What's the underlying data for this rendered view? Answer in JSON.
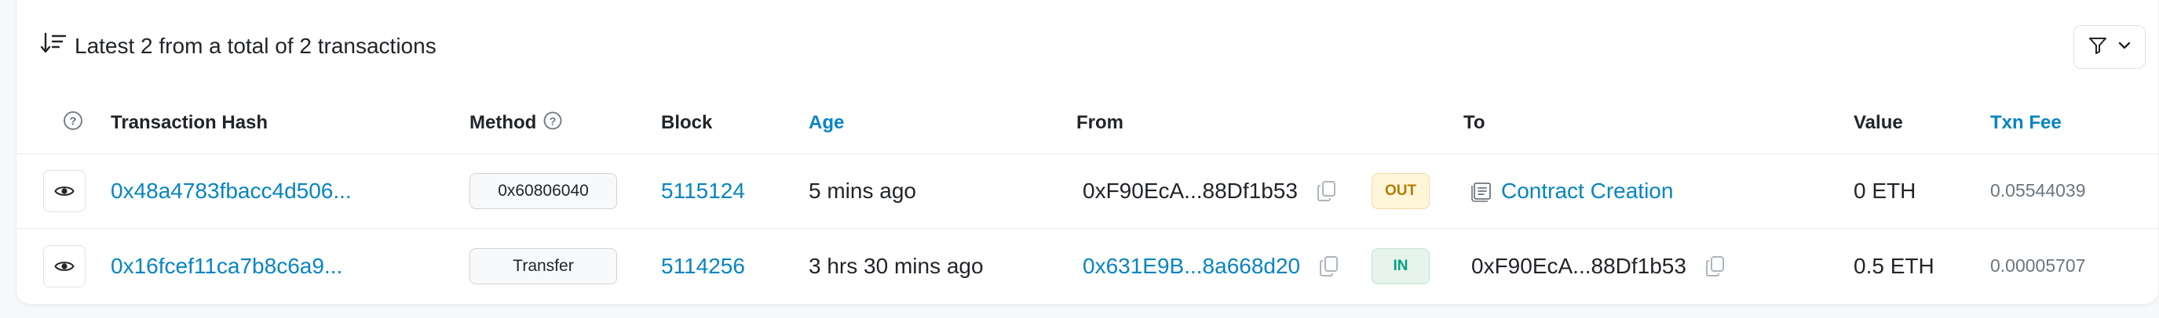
{
  "header": {
    "summary": "Latest 2 from a total of 2 transactions"
  },
  "columns": {
    "help": "?",
    "tx_hash": "Transaction Hash",
    "method": "Method",
    "block": "Block",
    "age": "Age",
    "from": "From",
    "to": "To",
    "value": "Value",
    "fee": "Txn Fee"
  },
  "rows": [
    {
      "hash": "0x48a4783fbacc4d506...",
      "method": "0x60806040",
      "block": "5115124",
      "age": "5 mins ago",
      "from": "0xF90EcA...88Df1b53",
      "direction": "OUT",
      "to": "Contract Creation",
      "value": "0 ETH",
      "fee": "0.05544039"
    },
    {
      "hash": "0x16fcef11ca7b8c6a9...",
      "method": "Transfer",
      "block": "5114256",
      "age": "3 hrs 30 mins ago",
      "from": "0x631E9B...8a668d20",
      "direction": "IN",
      "to": "0xF90EcA...88Df1b53",
      "value": "0.5 ETH",
      "fee": "0.00005707"
    }
  ],
  "colors": {
    "link": "#0784c3",
    "out_badge": "#b47d00",
    "in_badge": "#00a186"
  }
}
